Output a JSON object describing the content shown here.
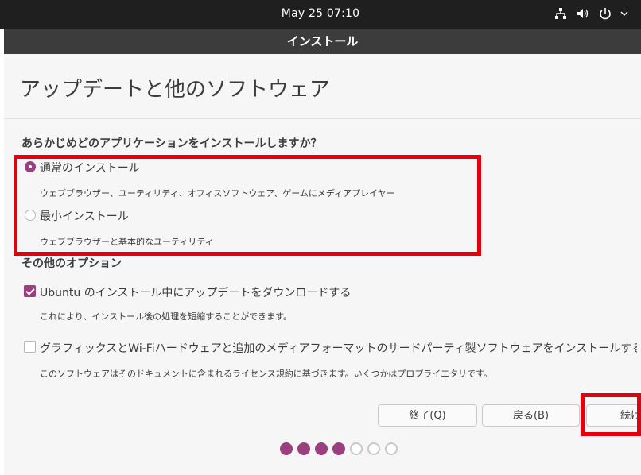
{
  "topbar": {
    "clock": "May 25  07:10",
    "tray_icons": [
      "network-icon",
      "volume-icon",
      "power-icon"
    ]
  },
  "window": {
    "title": "インストール",
    "page_title": "アップデートと他のソフトウェア"
  },
  "install_type": {
    "question": "あらかじめどのアプリケーションをインストールしますか？",
    "options": [
      {
        "label": "通常のインストール",
        "desc": "ウェブブラウザー、ユーティリティ、オフィスソフトウェア、ゲームにメディアプレイヤー",
        "selected": true
      },
      {
        "label": "最小インストール",
        "desc": "ウェブブラウザーと基本的なユーティリティ",
        "selected": false
      }
    ]
  },
  "other_options": {
    "title": "その他のオプション",
    "items": [
      {
        "label": "Ubuntu のインストール中にアップデートをダウンロードする",
        "desc": "これにより、インストール後の処理を短縮することができます。",
        "checked": true
      },
      {
        "label": "グラフィックスとWi-Fiハードウェアと追加のメディアフォーマットのサードパーティ製ソフトウェアをインストールする",
        "desc": "このソフトウェアはそのドキュメントに含まれるライセンス規約に基づきます。いくつかはプロプライエタリです。",
        "checked": false
      }
    ]
  },
  "buttons": {
    "quit": "終了(Q)",
    "back": "戻る(B)",
    "continue": "続ける"
  },
  "progress": {
    "current_step": 4,
    "total_steps": 7
  },
  "colors": {
    "accent": "#9b3f7f",
    "highlight": "#e3000f",
    "topbar": "#1f1f1f",
    "titlebar": "#3c3c3c"
  }
}
